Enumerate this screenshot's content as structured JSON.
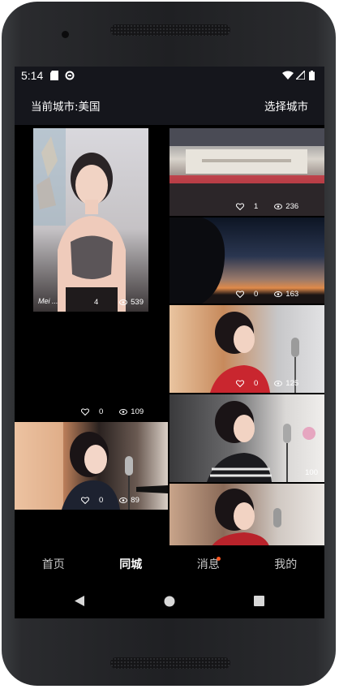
{
  "status_bar": {
    "time": "5:14",
    "icons": [
      "sd-card-icon",
      "data-saver-icon",
      "wifi-icon",
      "signal-icon",
      "battery-icon"
    ]
  },
  "header": {
    "city_label": "当前城市:美国",
    "choose_city": "选择城市"
  },
  "feed": {
    "items": [
      {
        "likes": "4",
        "views": "539",
        "caption": "Mei ..."
      },
      {
        "likes": "0",
        "views": "109"
      },
      {
        "likes": "0",
        "views": "89"
      },
      {
        "likes": "1",
        "views": "236"
      },
      {
        "likes": "0",
        "views": "163"
      },
      {
        "likes": "0",
        "views": "125"
      },
      {
        "likes": "",
        "views": "100"
      }
    ]
  },
  "bottom_nav": {
    "tabs": [
      "首页",
      "同城",
      "消息",
      "我的"
    ],
    "active": "同城"
  },
  "colors": {
    "bar_bg": "#15161c",
    "badge": "#ff5722",
    "accent_text": "#ffffff"
  }
}
